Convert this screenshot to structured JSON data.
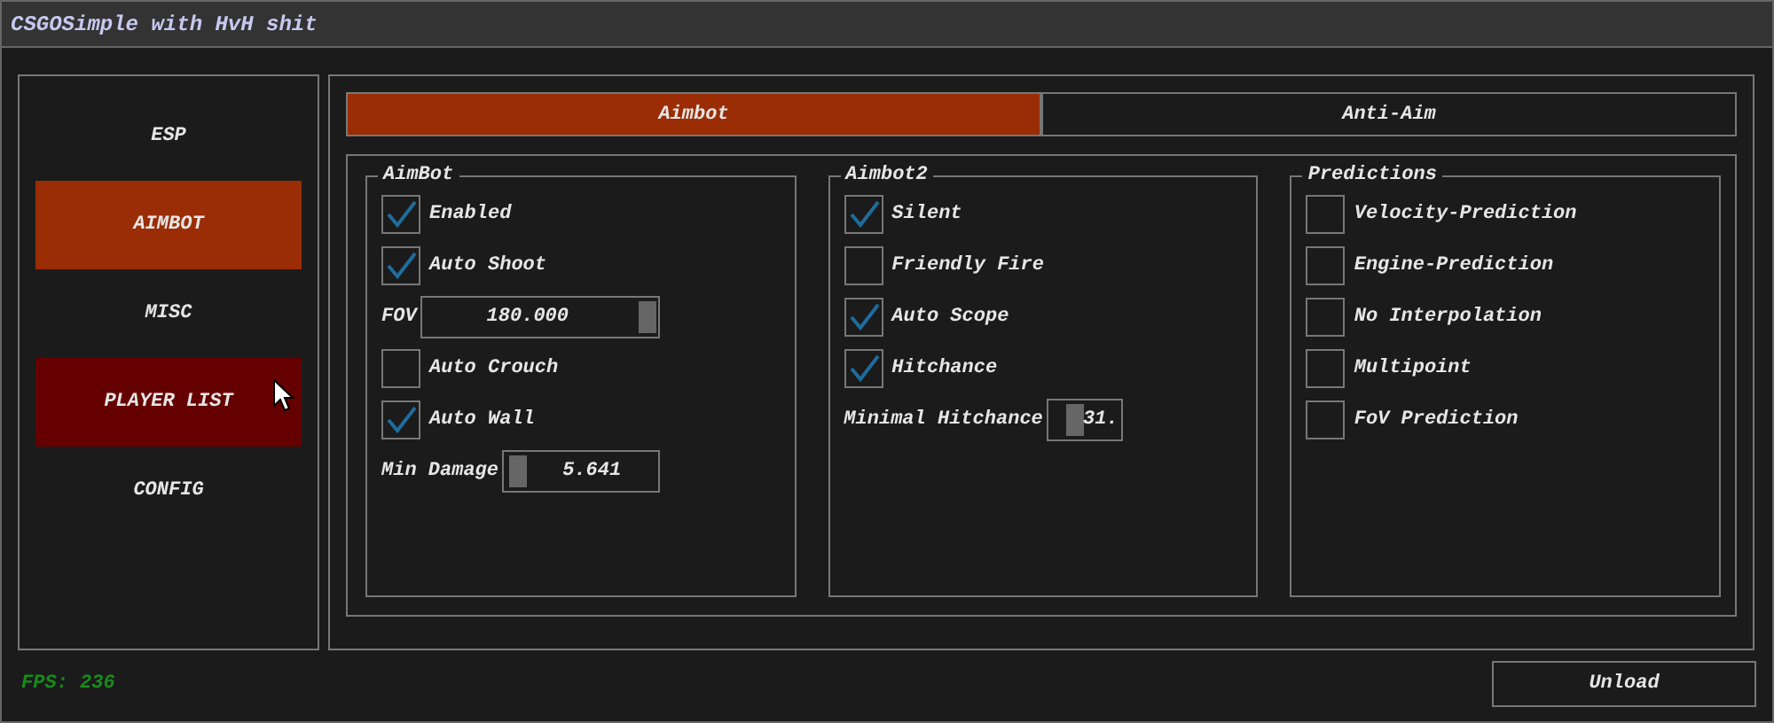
{
  "window": {
    "title": "CSGOSimple with HvH shit"
  },
  "sidebar": {
    "items": [
      {
        "label": "ESP",
        "selected": false,
        "hovered": false
      },
      {
        "label": "AIMBOT",
        "selected": true,
        "hovered": false
      },
      {
        "label": "MISC",
        "selected": false,
        "hovered": false
      },
      {
        "label": "PLAYER LIST",
        "selected": false,
        "hovered": true
      },
      {
        "label": "CONFIG",
        "selected": false,
        "hovered": false
      }
    ]
  },
  "tabs": [
    {
      "label": "Aimbot",
      "selected": true
    },
    {
      "label": "Anti-Aim",
      "selected": false
    }
  ],
  "groups": [
    {
      "title": "AimBot",
      "rows": [
        {
          "kind": "checkbox",
          "label": "Enabled",
          "checked": true
        },
        {
          "kind": "checkbox",
          "label": "Auto Shoot",
          "checked": true
        },
        {
          "kind": "slider",
          "label": "FOV",
          "value": "180.000",
          "level": 1.0
        },
        {
          "kind": "checkbox",
          "label": "Auto Crouch",
          "checked": false
        },
        {
          "kind": "checkbox",
          "label": "Auto Wall",
          "checked": true
        },
        {
          "kind": "slider",
          "label": "Min Damage",
          "value": "5.641",
          "level": 0.03
        }
      ]
    },
    {
      "title": "Aimbot2",
      "rows": [
        {
          "kind": "checkbox",
          "label": "Silent",
          "checked": true
        },
        {
          "kind": "checkbox",
          "label": "Friendly Fire",
          "checked": false
        },
        {
          "kind": "checkbox",
          "label": "Auto Scope",
          "checked": true
        },
        {
          "kind": "checkbox",
          "label": "Hitchance",
          "checked": true
        },
        {
          "kind": "slider",
          "label": "Minimal Hitchance",
          "value": "31.",
          "level": 0.31
        }
      ]
    },
    {
      "title": "Predictions",
      "rows": [
        {
          "kind": "checkbox",
          "label": "Velocity-Prediction",
          "checked": false
        },
        {
          "kind": "checkbox",
          "label": "Engine-Prediction",
          "checked": false
        },
        {
          "kind": "checkbox",
          "label": "No Interpolation",
          "checked": false
        },
        {
          "kind": "checkbox",
          "label": "Multipoint",
          "checked": false
        },
        {
          "kind": "checkbox",
          "label": "FoV Prediction",
          "checked": false
        }
      ]
    }
  ],
  "footer": {
    "fps": "FPS: 236",
    "unload_button": "Unload"
  }
}
